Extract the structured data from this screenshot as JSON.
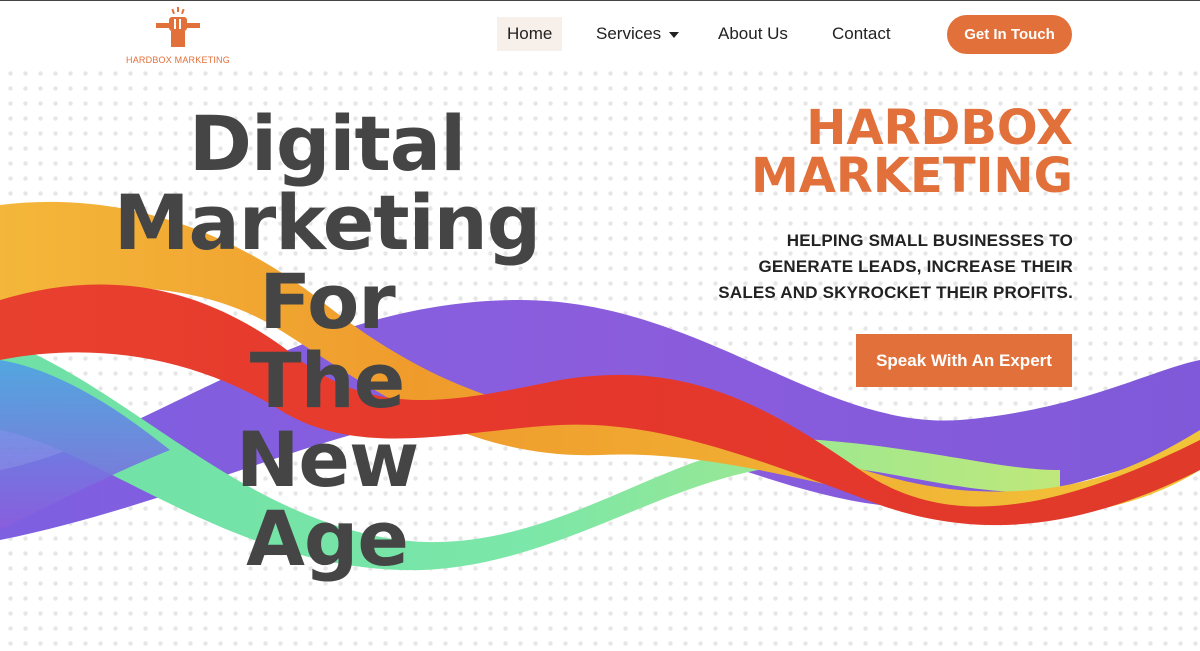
{
  "header": {
    "logo_text": "HARDBOX MARKETING",
    "nav": [
      {
        "label": "Home",
        "active": true
      },
      {
        "label": "Services",
        "has_dropdown": true
      },
      {
        "label": "About Us"
      },
      {
        "label": "Contact"
      }
    ],
    "cta_label": "Get In Touch"
  },
  "hero": {
    "headline_lines": [
      "Digital",
      "Marketing",
      "For",
      "The",
      "New",
      "Age"
    ],
    "brand_lines": [
      "HARDBOX",
      "MARKETING"
    ],
    "tagline_lines": [
      "HELPING SMALL BUSINESSES TO",
      "GENERATE LEADS, INCREASE THEIR",
      "SALES AND SKYROCKET THEIR PROFITS."
    ],
    "cta_label": "Speak With An Expert"
  },
  "colors": {
    "accent": "#e2703a",
    "heading": "#454545",
    "wave": [
      "#f2c12e",
      "#e63a2a",
      "#8a5ee0",
      "#6fe3a0",
      "#4fa8e8"
    ]
  },
  "icons": [
    "fist-pencil-logo-icon",
    "chevron-down-icon"
  ]
}
